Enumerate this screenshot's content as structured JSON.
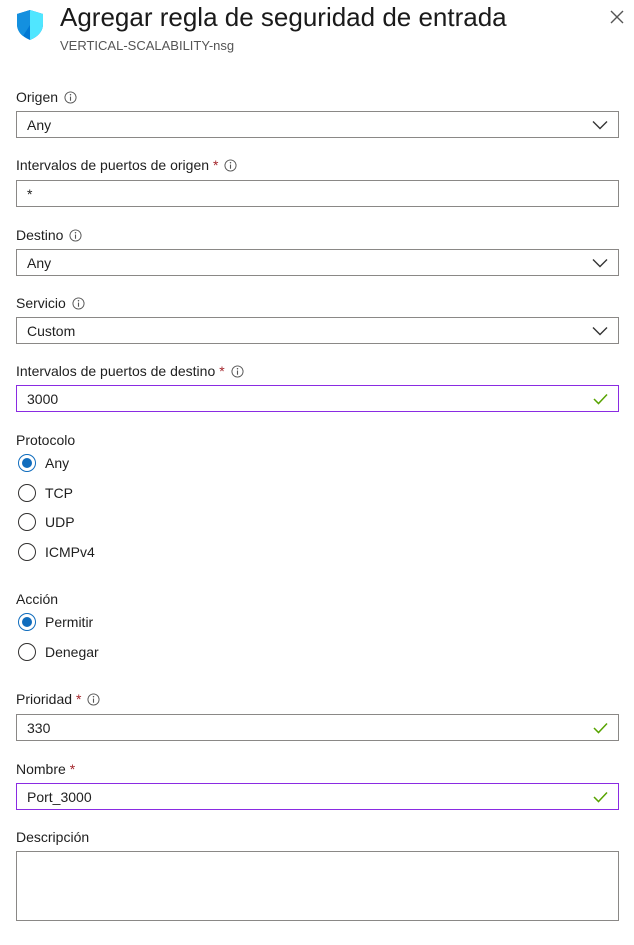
{
  "header": {
    "title": "Agregar regla de seguridad de entrada",
    "subtitle": "VERTICAL-SCALABILITY-nsg",
    "logo_icon": "shield-icon",
    "close_icon": "close-icon"
  },
  "fields": {
    "origen": {
      "label": "Origen",
      "value": "Any"
    },
    "puertos_origen": {
      "label": "Intervalos de puertos de origen",
      "required_mark": "*",
      "value": "*"
    },
    "destino": {
      "label": "Destino",
      "value": "Any"
    },
    "servicio": {
      "label": "Servicio",
      "value": "Custom"
    },
    "puertos_destino": {
      "label": "Intervalos de puertos de destino",
      "required_mark": "*",
      "value": "3000"
    },
    "protocolo": {
      "label": "Protocolo",
      "options": [
        "Any",
        "TCP",
        "UDP",
        "ICMPv4"
      ],
      "selected": "Any"
    },
    "accion": {
      "label": "Acción",
      "options": [
        "Permitir",
        "Denegar"
      ],
      "selected": "Permitir"
    },
    "prioridad": {
      "label": "Prioridad",
      "required_mark": "*",
      "value": "330"
    },
    "nombre": {
      "label": "Nombre",
      "required_mark": "*",
      "value": "Port_3000"
    },
    "descripcion": {
      "label": "Descripción",
      "value": ""
    }
  },
  "colors": {
    "accent": "#0f6cbd",
    "required": "#a4262c",
    "valid_border": "#8a2be2",
    "valid_check": "#57a300",
    "shield_light": "#50e6ff",
    "shield_dark": "#0078d4"
  }
}
